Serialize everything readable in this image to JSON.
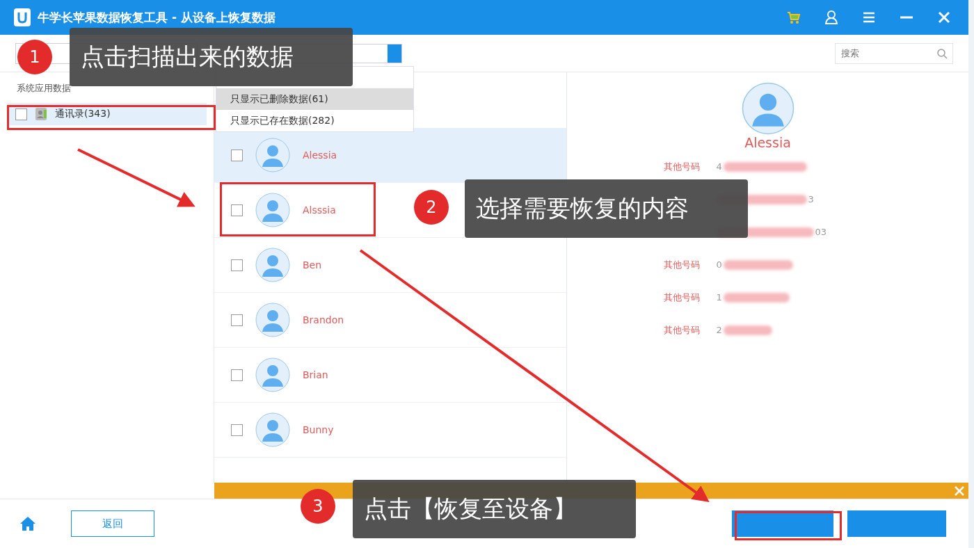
{
  "window": {
    "title": "牛学长苹果数据恢复工具 - 从设备上恢复数据"
  },
  "search": {
    "placeholder": "搜索"
  },
  "filter_menu": {
    "items": [
      {
        "label": "只显示已删除数据(61)",
        "selected": true
      },
      {
        "label": "只显示已存在数据(282)",
        "selected": false
      }
    ]
  },
  "sidebar": {
    "heading": "系统应用数据",
    "items": [
      {
        "label": "通讯录(343)",
        "checked": false,
        "selected": true
      }
    ]
  },
  "contacts": [
    {
      "name": "Alessia",
      "checked": false,
      "selected": true
    },
    {
      "name": "Alsssia",
      "checked": false,
      "selected": false
    },
    {
      "name": "Ben",
      "checked": false,
      "selected": false
    },
    {
      "name": "Brandon",
      "checked": false,
      "selected": false
    },
    {
      "name": "Brian",
      "checked": false,
      "selected": false
    },
    {
      "name": "Bunny",
      "checked": false,
      "selected": false
    }
  ],
  "detail": {
    "name": "Alessia",
    "fields": [
      {
        "label": "其他号码",
        "value_start": "4"
      },
      {
        "value_end": "3"
      },
      {
        "value_end": "03"
      },
      {
        "label": "其他号码",
        "value_start": "0"
      },
      {
        "label": "其他号码",
        "value_start": "1"
      },
      {
        "label": "其他号码",
        "value_start": "2"
      }
    ]
  },
  "bottom_bar": {
    "back_button": "返回"
  },
  "annotations": [
    {
      "number": "1",
      "text": "点击扫描出来的数据"
    },
    {
      "number": "2",
      "text": "选择需要恢复的内容"
    },
    {
      "number": "3",
      "text": "点击【恢复至设备】"
    }
  ]
}
